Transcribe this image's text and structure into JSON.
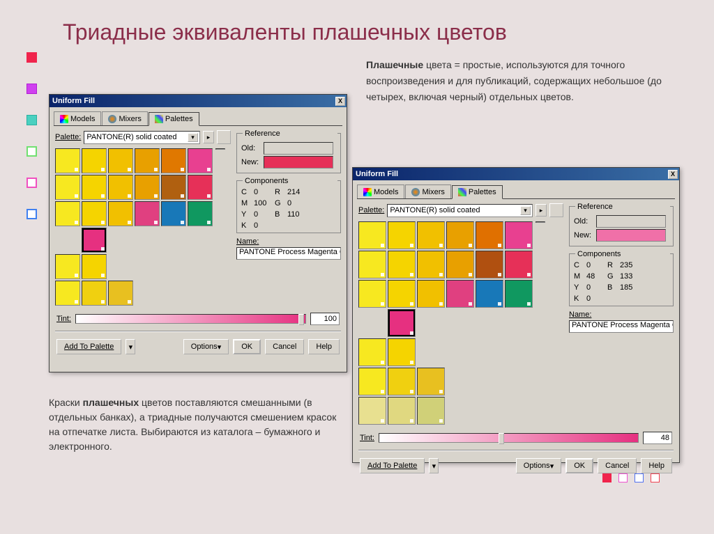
{
  "slide": {
    "title": "Триадные эквиваленты плашечных цветов",
    "desc_right_bold": "Плашечные",
    "desc_right": " цвета = простые, используются для точного воспроизведения  и для публикаций, содержащих небольшое (до четырех, включая черный) отдельных цветов.",
    "desc_bottom_pre": "Краски ",
    "desc_bottom_bold": "плашечных",
    "desc_bottom": " цветов поставляются смешанными (в отдельных банках), а триадные получаются смешением красок на отпечатке листа. Выбираются из каталога – бумажного и электронного."
  },
  "bullets": [
    "b-red",
    "b-mag",
    "b-teal",
    "b-green",
    "b-pink",
    "b-blue"
  ],
  "dialog": {
    "title": "Uniform Fill",
    "close": "X",
    "tabs": {
      "models": "Models",
      "mixers": "Mixers",
      "palettes": "Palettes"
    },
    "palette_label": "Palette:",
    "palette_value": "PANTONE(R) solid coated",
    "ref_legend": "Reference",
    "old_label": "Old:",
    "new_label": "New:",
    "comp_legend": "Components",
    "name_label": "Name:",
    "tint_label": "Tint:",
    "buttons": {
      "add": "Add To Palette",
      "options": "Options",
      "ok": "OK",
      "cancel": "Cancel",
      "help": "Help"
    }
  },
  "d1": {
    "old_color": "#d8d4cc",
    "new_color": "#e63058",
    "comp": {
      "C": "0",
      "M": "100",
      "Y": "0",
      "K": "0",
      "R": "214",
      "G": "0",
      "B": "110"
    },
    "name": "PANTONE Process Magenta C",
    "tint": "100",
    "swatches": [
      [
        "#f7e820",
        "#f5d400",
        "#f1c000",
        "#e8a000",
        "#e07800",
        "#e84090"
      ],
      [
        "#f7e820",
        "#f5d400",
        "#f1c000",
        "#e8a000",
        "#b06010",
        "#e63058"
      ],
      [
        "#f7e820",
        "#f5d400",
        "#f1c000",
        "#e04080",
        "#1878b8",
        "#109860"
      ],
      [
        "",
        "#e63080",
        "",
        "",
        "",
        ""
      ],
      [
        "#f7e820",
        "#f5d400",
        "",
        "",
        "",
        ""
      ],
      [
        "#f7e820",
        "#f0d010",
        "#e8c020",
        "",
        "",
        ""
      ]
    ],
    "selected": [
      3,
      1
    ]
  },
  "d2": {
    "old_color": "#d8d4cc",
    "new_color": "#f070a8",
    "comp": {
      "C": "0",
      "M": "48",
      "Y": "0",
      "K": "0",
      "R": "235",
      "G": "133",
      "B": "185"
    },
    "name": "PANTONE Process Magenta C",
    "tint": "48",
    "swatches": [
      [
        "#f7e820",
        "#f5d400",
        "#f1c000",
        "#e8a000",
        "#e07000",
        "#e84090"
      ],
      [
        "#f7e820",
        "#f5d400",
        "#f1c000",
        "#e8a000",
        "#b05010",
        "#e63058"
      ],
      [
        "#f7e820",
        "#f5d400",
        "#f1c000",
        "#e04080",
        "#1878b8",
        "#109860"
      ],
      [
        "",
        "#e63080",
        "",
        "",
        "",
        ""
      ],
      [
        "#f7e820",
        "#f5d400",
        "",
        "",
        "",
        ""
      ],
      [
        "#f7e820",
        "#f0d010",
        "#e8c020",
        "",
        "",
        ""
      ],
      [
        "#e8e090",
        "#e0d880",
        "#d0d078",
        "",
        "",
        ""
      ]
    ],
    "selected": [
      3,
      1
    ]
  }
}
